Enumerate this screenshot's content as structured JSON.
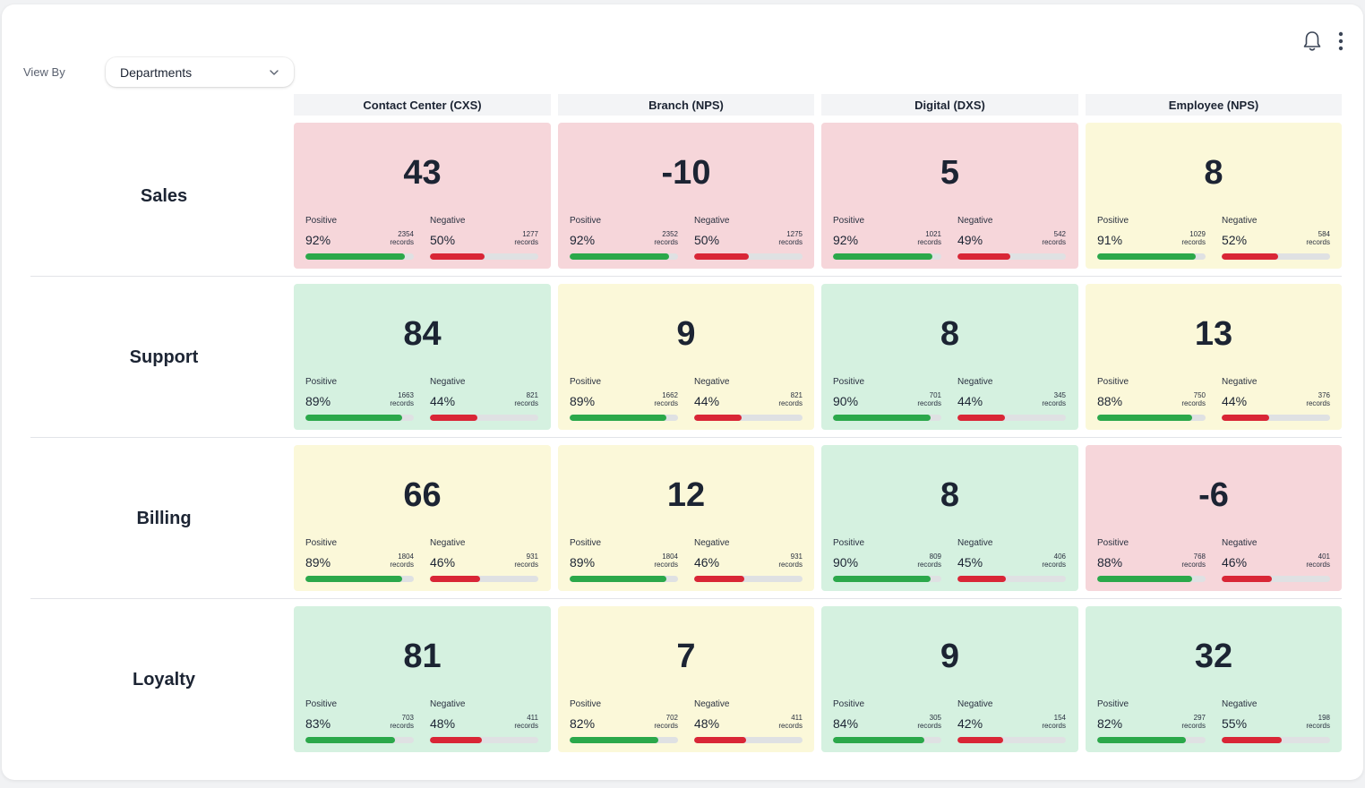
{
  "toolbar": {
    "bell_icon": "bell-icon",
    "menu_icon": "more-vertical-icon"
  },
  "view_by": {
    "label": "View By",
    "selected": "Departments"
  },
  "columns": [
    "Contact Center (CXS)",
    "Branch (NPS)",
    "Digital (DXS)",
    "Employee (NPS)"
  ],
  "metric_labels": {
    "positive": "Positive",
    "negative": "Negative",
    "records": "records"
  },
  "colors": {
    "red_card": "#f6d6da",
    "yellow_card": "#fbf8d9",
    "green_card": "#d5f1e0",
    "positive_bar": "#2ba84a",
    "negative_bar": "#d92636"
  },
  "rows": [
    {
      "label": "Sales",
      "cells": [
        {
          "score": "43",
          "status": "red",
          "pos_pct": "92%",
          "pos_records": "2354",
          "neg_pct": "50%",
          "neg_records": "1277",
          "pos_value": 92,
          "neg_value": 50
        },
        {
          "score": "-10",
          "status": "red",
          "pos_pct": "92%",
          "pos_records": "2352",
          "neg_pct": "50%",
          "neg_records": "1275",
          "pos_value": 92,
          "neg_value": 50
        },
        {
          "score": "5",
          "status": "red",
          "pos_pct": "92%",
          "pos_records": "1021",
          "neg_pct": "49%",
          "neg_records": "542",
          "pos_value": 92,
          "neg_value": 49
        },
        {
          "score": "8",
          "status": "yellow",
          "pos_pct": "91%",
          "pos_records": "1029",
          "neg_pct": "52%",
          "neg_records": "584",
          "pos_value": 91,
          "neg_value": 52
        }
      ]
    },
    {
      "label": "Support",
      "cells": [
        {
          "score": "84",
          "status": "green",
          "pos_pct": "89%",
          "pos_records": "1663",
          "neg_pct": "44%",
          "neg_records": "821",
          "pos_value": 89,
          "neg_value": 44
        },
        {
          "score": "9",
          "status": "yellow",
          "pos_pct": "89%",
          "pos_records": "1662",
          "neg_pct": "44%",
          "neg_records": "821",
          "pos_value": 89,
          "neg_value": 44
        },
        {
          "score": "8",
          "status": "green",
          "pos_pct": "90%",
          "pos_records": "701",
          "neg_pct": "44%",
          "neg_records": "345",
          "pos_value": 90,
          "neg_value": 44
        },
        {
          "score": "13",
          "status": "yellow",
          "pos_pct": "88%",
          "pos_records": "750",
          "neg_pct": "44%",
          "neg_records": "376",
          "pos_value": 88,
          "neg_value": 44
        }
      ]
    },
    {
      "label": "Billing",
      "cells": [
        {
          "score": "66",
          "status": "yellow",
          "pos_pct": "89%",
          "pos_records": "1804",
          "neg_pct": "46%",
          "neg_records": "931",
          "pos_value": 89,
          "neg_value": 46
        },
        {
          "score": "12",
          "status": "yellow",
          "pos_pct": "89%",
          "pos_records": "1804",
          "neg_pct": "46%",
          "neg_records": "931",
          "pos_value": 89,
          "neg_value": 46
        },
        {
          "score": "8",
          "status": "green",
          "pos_pct": "90%",
          "pos_records": "809",
          "neg_pct": "45%",
          "neg_records": "406",
          "pos_value": 90,
          "neg_value": 45
        },
        {
          "score": "-6",
          "status": "red",
          "pos_pct": "88%",
          "pos_records": "768",
          "neg_pct": "46%",
          "neg_records": "401",
          "pos_value": 88,
          "neg_value": 46
        }
      ]
    },
    {
      "label": "Loyalty",
      "cells": [
        {
          "score": "81",
          "status": "green",
          "pos_pct": "83%",
          "pos_records": "703",
          "neg_pct": "48%",
          "neg_records": "411",
          "pos_value": 83,
          "neg_value": 48
        },
        {
          "score": "7",
          "status": "yellow",
          "pos_pct": "82%",
          "pos_records": "702",
          "neg_pct": "48%",
          "neg_records": "411",
          "pos_value": 82,
          "neg_value": 48
        },
        {
          "score": "9",
          "status": "green",
          "pos_pct": "84%",
          "pos_records": "305",
          "neg_pct": "42%",
          "neg_records": "154",
          "pos_value": 84,
          "neg_value": 42
        },
        {
          "score": "32",
          "status": "green",
          "pos_pct": "82%",
          "pos_records": "297",
          "neg_pct": "55%",
          "neg_records": "198",
          "pos_value": 82,
          "neg_value": 55
        }
      ]
    }
  ]
}
